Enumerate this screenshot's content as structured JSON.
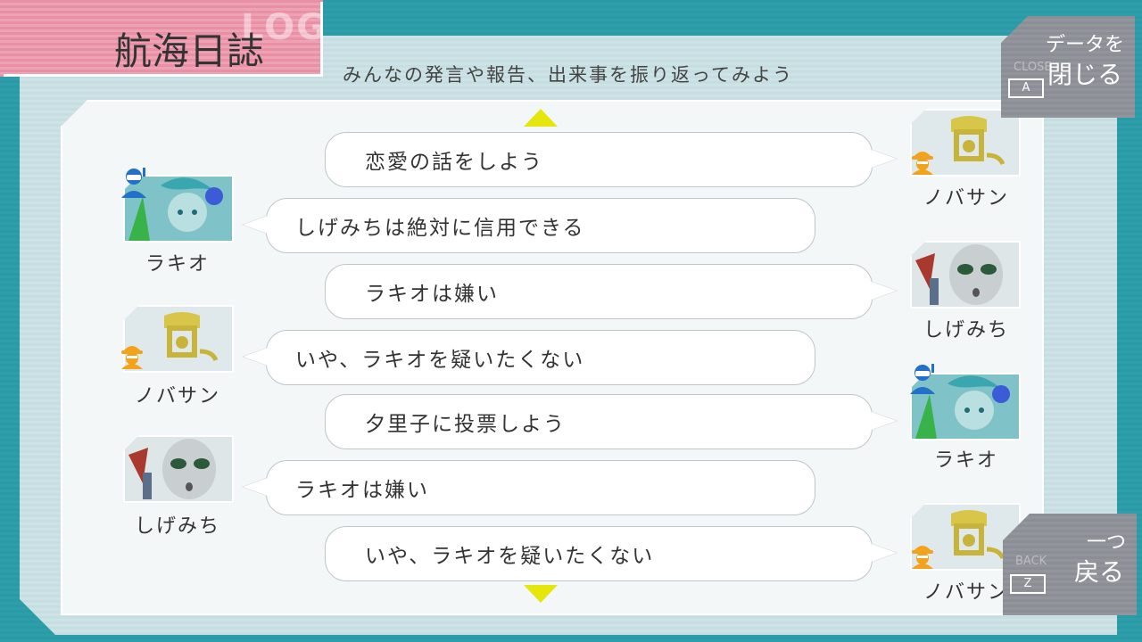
{
  "header": {
    "title": "航海日誌",
    "title_bg_text": "LOG",
    "subtitle": "みんなの発言や報告、出来事を振り返ってみよう"
  },
  "close_button": {
    "label_line1": "データを",
    "label_line2": "閉じる",
    "ghost": "CLOSE",
    "key": "A"
  },
  "back_button": {
    "label_line1": "一つ",
    "label_line2": "戻る",
    "ghost": "BACK",
    "key": "Z"
  },
  "log": [
    {
      "side": "right",
      "speaker": "ノバサン",
      "role": "engineer",
      "text": "恋愛の話をしよう"
    },
    {
      "side": "left",
      "speaker": "ラキオ",
      "role": "crew",
      "text": "しげみちは絶対に信用できる"
    },
    {
      "side": "right",
      "speaker": "しげみち",
      "role": "none",
      "text": "ラキオは嫌い"
    },
    {
      "side": "left",
      "speaker": "ノバサン",
      "role": "engineer",
      "text": "いや、ラキオを疑いたくない"
    },
    {
      "side": "right",
      "speaker": "ラキオ",
      "role": "crew",
      "text": "夕里子に投票しよう"
    },
    {
      "side": "left",
      "speaker": "しげみち",
      "role": "none",
      "text": "ラキオは嫌い"
    },
    {
      "side": "right",
      "speaker": "ノバサン",
      "role": "engineer",
      "text": "いや、ラキオを疑いたくない"
    }
  ],
  "colors": {
    "teal_bg": "#2a9aa6",
    "pink_tab": "#e98fa6",
    "scroll_arrow": "#e4e60c",
    "engineer_icon": "#f2a21b",
    "crew_icon": "#2270c8"
  },
  "icons": {
    "scroll_up": "triangle-up-icon",
    "scroll_down": "triangle-down-icon"
  }
}
